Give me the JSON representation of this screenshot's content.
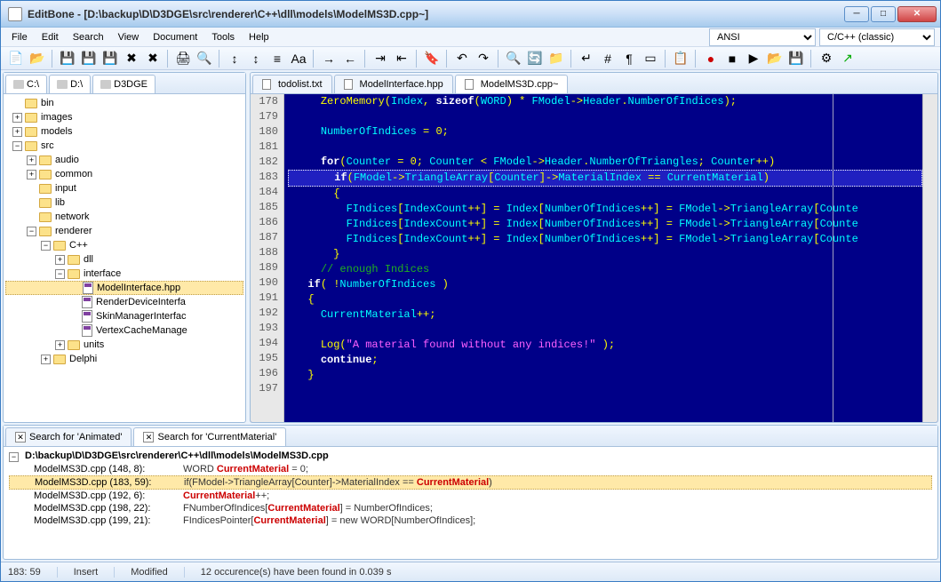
{
  "window": {
    "title": "EditBone - [D:\\backup\\D\\D3DGE\\src\\renderer\\C++\\dll\\models\\ModelMS3D.cpp~]"
  },
  "menus": [
    "File",
    "Edit",
    "Search",
    "View",
    "Document",
    "Tools",
    "Help"
  ],
  "encoding_combo": {
    "value": "ANSI"
  },
  "language_combo": {
    "value": "C/C++ (classic)"
  },
  "drives": [
    {
      "label": "C:\\"
    },
    {
      "label": "D:\\"
    },
    {
      "label": "D3DGE"
    }
  ],
  "tree": [
    {
      "depth": 0,
      "exp": "",
      "kind": "folder",
      "label": "bin"
    },
    {
      "depth": 0,
      "exp": "+",
      "kind": "folder",
      "label": "images"
    },
    {
      "depth": 0,
      "exp": "+",
      "kind": "folder",
      "label": "models"
    },
    {
      "depth": 0,
      "exp": "-",
      "kind": "folder",
      "label": "src"
    },
    {
      "depth": 1,
      "exp": "+",
      "kind": "folder",
      "label": "audio"
    },
    {
      "depth": 1,
      "exp": "+",
      "kind": "folder",
      "label": "common"
    },
    {
      "depth": 1,
      "exp": "",
      "kind": "folder",
      "label": "input"
    },
    {
      "depth": 1,
      "exp": "",
      "kind": "folder",
      "label": "lib"
    },
    {
      "depth": 1,
      "exp": "",
      "kind": "folder",
      "label": "network"
    },
    {
      "depth": 1,
      "exp": "-",
      "kind": "folder",
      "label": "renderer"
    },
    {
      "depth": 2,
      "exp": "-",
      "kind": "folder",
      "label": "C++"
    },
    {
      "depth": 3,
      "exp": "+",
      "kind": "folder",
      "label": "dll"
    },
    {
      "depth": 3,
      "exp": "-",
      "kind": "folder",
      "label": "interface"
    },
    {
      "depth": 4,
      "exp": "",
      "kind": "hpp",
      "label": "ModelInterface.hpp",
      "selected": true
    },
    {
      "depth": 4,
      "exp": "",
      "kind": "hpp",
      "label": "RenderDeviceInterfa"
    },
    {
      "depth": 4,
      "exp": "",
      "kind": "hpp",
      "label": "SkinManagerInterfac"
    },
    {
      "depth": 4,
      "exp": "",
      "kind": "hpp",
      "label": "VertexCacheManage"
    },
    {
      "depth": 3,
      "exp": "+",
      "kind": "folder",
      "label": "units"
    },
    {
      "depth": 2,
      "exp": "+",
      "kind": "folder",
      "label": "Delphi"
    }
  ],
  "file_tabs": [
    {
      "label": "todolist.txt",
      "active": false
    },
    {
      "label": "ModelInterface.hpp",
      "active": false
    },
    {
      "label": "ModelMS3D.cpp~",
      "active": true
    }
  ],
  "editor": {
    "first_line": 178,
    "lines": [
      {
        "n": 178,
        "html": "    <span class='fn'>ZeroMemory</span><span class='op'>(</span><span class='id'>Index</span><span class='op'>, </span><span class='kw'>sizeof</span><span class='op'>(</span><span class='id'>WORD</span><span class='op'>) * </span><span class='id'>FModel</span><span class='op'>-></span><span class='id'>Header</span><span class='op'>.</span><span class='id'>NumberOfIndices</span><span class='op'>);</span>"
      },
      {
        "n": 179,
        "html": ""
      },
      {
        "n": 180,
        "html": "    <span class='id'>NumberOfIndices</span> <span class='op'>=</span> <span class='num'>0</span><span class='op'>;</span>"
      },
      {
        "n": 181,
        "html": ""
      },
      {
        "n": 182,
        "html": "    <span class='kw'>for</span><span class='op'>(</span><span class='id'>Counter</span> <span class='op'>=</span> <span class='num'>0</span><span class='op'>; </span><span class='id'>Counter</span> <span class='op'>&lt;</span> <span class='id'>FModel</span><span class='op'>-></span><span class='id'>Header</span><span class='op'>.</span><span class='id'>NumberOfTriangles</span><span class='op'>; </span><span class='id'>Counter</span><span class='op'>++)</span>"
      },
      {
        "n": 183,
        "html": "      <span class='kw'>if</span><span class='op'>(</span><span class='id'>FModel</span><span class='op'>-></span><span class='id'>TriangleArray</span><span class='op'>[</span><span class='id'>Counter</span><span class='op'>]-></span><span class='id'>MaterialIndex</span> <span class='op'>==</span> <span class='id'>CurrentMaterial</span><span class='op'>)</span>",
        "hl": true
      },
      {
        "n": 184,
        "html": "      <span class='op'>{</span>"
      },
      {
        "n": 185,
        "html": "        <span class='id'>FIndices</span><span class='op'>[</span><span class='id'>IndexCount</span><span class='op'>++] = </span><span class='id'>Index</span><span class='op'>[</span><span class='id'>NumberOfIndices</span><span class='op'>++] = </span><span class='id'>FModel</span><span class='op'>-></span><span class='id'>TriangleArray</span><span class='op'>[</span><span class='id'>Counte</span>"
      },
      {
        "n": 186,
        "html": "        <span class='id'>FIndices</span><span class='op'>[</span><span class='id'>IndexCount</span><span class='op'>++] = </span><span class='id'>Index</span><span class='op'>[</span><span class='id'>NumberOfIndices</span><span class='op'>++] = </span><span class='id'>FModel</span><span class='op'>-></span><span class='id'>TriangleArray</span><span class='op'>[</span><span class='id'>Counte</span>"
      },
      {
        "n": 187,
        "html": "        <span class='id'>FIndices</span><span class='op'>[</span><span class='id'>IndexCount</span><span class='op'>++] = </span><span class='id'>Index</span><span class='op'>[</span><span class='id'>NumberOfIndices</span><span class='op'>++] = </span><span class='id'>FModel</span><span class='op'>-></span><span class='id'>TriangleArray</span><span class='op'>[</span><span class='id'>Counte</span>"
      },
      {
        "n": 188,
        "html": "      <span class='op'>}</span>"
      },
      {
        "n": 189,
        "html": "    <span class='cmt'>// enough Indices</span>"
      },
      {
        "n": 190,
        "html": "  <span class='kw'>if</span><span class='op'>( !</span><span class='id'>NumberOfIndices</span> <span class='op'>)</span>"
      },
      {
        "n": 191,
        "html": "  <span class='op'>{</span>"
      },
      {
        "n": 192,
        "html": "    <span class='id'>CurrentMaterial</span><span class='op'>++;</span>"
      },
      {
        "n": 193,
        "html": ""
      },
      {
        "n": 194,
        "html": "    <span class='fn'>Log</span><span class='op'>(</span><span class='str'>\"A material found without any indices!\"</span> <span class='op'>);</span>"
      },
      {
        "n": 195,
        "html": "    <span class='kw'>continue</span><span class='op'>;</span>"
      },
      {
        "n": 196,
        "html": "  <span class='op'>}</span>"
      },
      {
        "n": 197,
        "html": ""
      }
    ]
  },
  "search_tabs": [
    {
      "label": "Search for 'Animated'",
      "icon": "✕",
      "active": false
    },
    {
      "label": "Search for 'CurrentMaterial'",
      "icon": "✕",
      "active": true
    }
  ],
  "search_results": {
    "file": "D:\\backup\\D\\D3DGE\\src\\renderer\\C++\\dll\\models\\ModelMS3D.cpp",
    "rows": [
      {
        "loc": "ModelMS3D.cpp (148, 8):",
        "pre": "WORD ",
        "term": "CurrentMaterial",
        "post": " = 0;",
        "sel": false
      },
      {
        "loc": "ModelMS3D.cpp (183, 59):",
        "pre": "     if(FModel->TriangleArray[Counter]->MaterialIndex == ",
        "term": "CurrentMaterial",
        "post": ")",
        "sel": true
      },
      {
        "loc": "ModelMS3D.cpp (192, 6):",
        "pre": "",
        "term": "CurrentMaterial",
        "post": "++;",
        "sel": false
      },
      {
        "loc": "ModelMS3D.cpp (198, 22):",
        "pre": "FNumberOfIndices[",
        "term": "CurrentMaterial",
        "post": "] = NumberOfIndices;",
        "sel": false
      },
      {
        "loc": "ModelMS3D.cpp (199, 21):",
        "pre": "FIndicesPointer[",
        "term": "CurrentMaterial",
        "post": "] = new WORD[NumberOfIndices];",
        "sel": false
      }
    ]
  },
  "status": {
    "pos": "183: 59",
    "mode": "Insert",
    "state": "Modified",
    "message": "12 occurence(s) have been found in 0.039 s"
  }
}
